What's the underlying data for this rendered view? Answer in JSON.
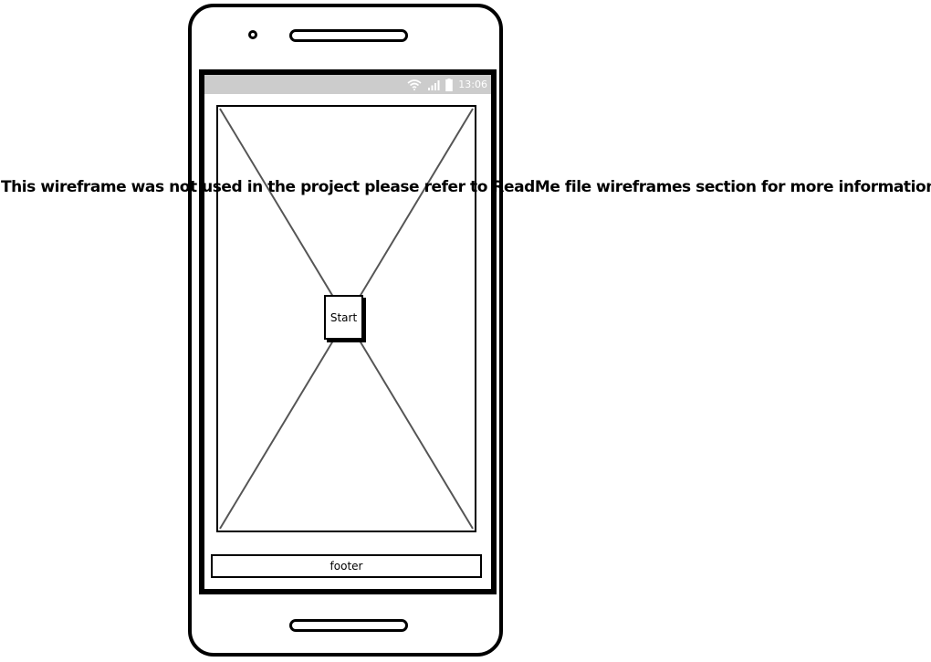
{
  "status_bar": {
    "time": "13:06",
    "icons": [
      "wifi-icon",
      "signal-icon",
      "battery-icon"
    ]
  },
  "hero": {
    "type": "image-placeholder"
  },
  "start_button": {
    "label": "Start"
  },
  "footer": {
    "label": "footer"
  },
  "note": {
    "text": "This wireframe was not used in the project please refer to ReadMe file wireframes section for more information"
  }
}
